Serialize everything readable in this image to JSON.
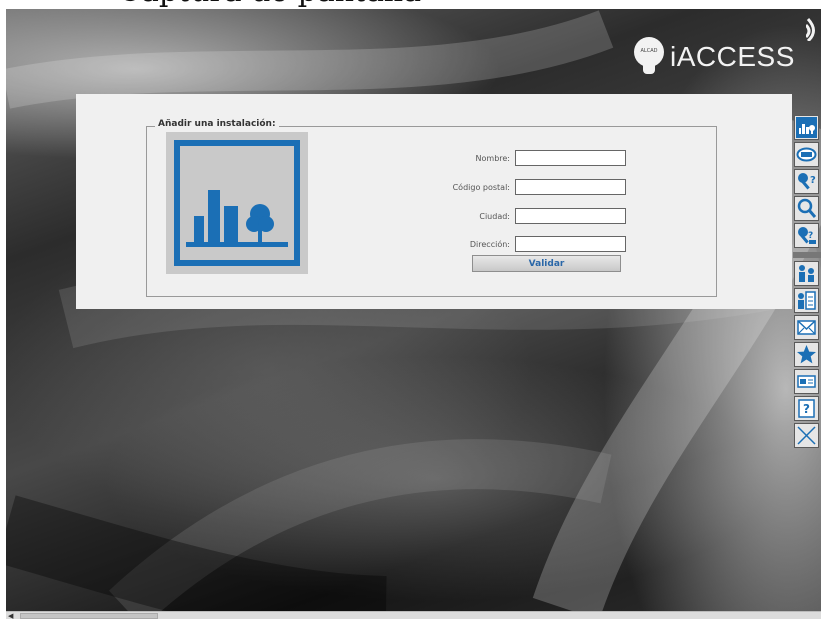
{
  "page_header_fragment": "Captura de pantalla",
  "logo": {
    "badge_text": "ALCAD",
    "text": "iACCESS"
  },
  "form": {
    "legend": "Añadir una instalación:",
    "fields": [
      {
        "label": "Nombre:",
        "value": ""
      },
      {
        "label": "Código postal:",
        "value": ""
      },
      {
        "label": "Ciudad:",
        "value": ""
      },
      {
        "label": "Dirección:",
        "value": ""
      }
    ],
    "submit_label": "Validar"
  },
  "sidebar": {
    "items": [
      {
        "name": "installations",
        "icon": "building-tree-icon"
      },
      {
        "name": "tag",
        "icon": "tag-icon"
      },
      {
        "name": "key-question",
        "icon": "key-question-icon"
      },
      {
        "name": "search",
        "icon": "magnifier-icon"
      },
      {
        "name": "key-user",
        "icon": "key-user-icon"
      },
      {
        "name": "users",
        "icon": "users-icon"
      },
      {
        "name": "user-list",
        "icon": "user-list-icon"
      },
      {
        "name": "messages",
        "icon": "envelope-icon"
      },
      {
        "name": "favorites",
        "icon": "star-icon"
      },
      {
        "name": "card",
        "icon": "card-icon"
      },
      {
        "name": "help",
        "icon": "question-icon"
      },
      {
        "name": "close",
        "icon": "close-icon"
      }
    ]
  },
  "colors": {
    "accent": "#1b6fb5",
    "panel": "#f0f0f0",
    "button_text": "#2a67a8"
  }
}
